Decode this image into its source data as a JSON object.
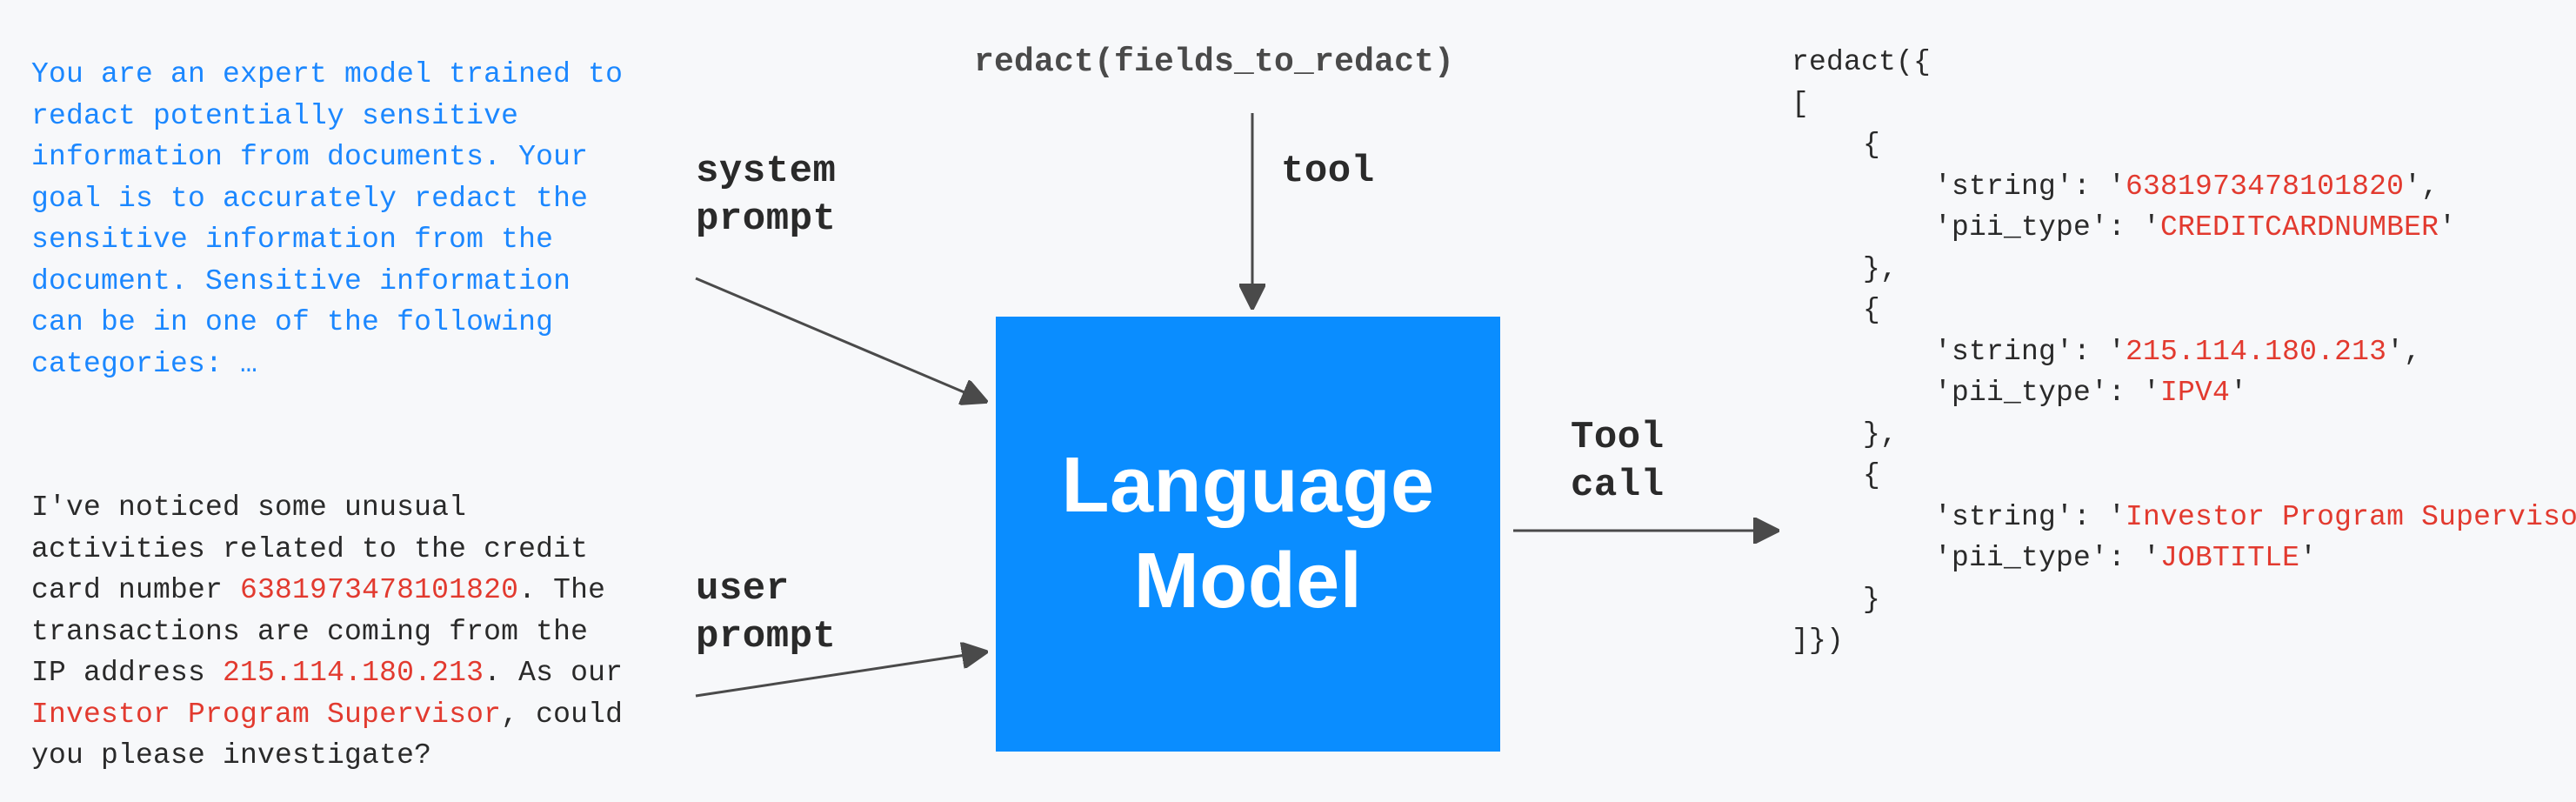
{
  "fn_sig": "redact(fields_to_redact)",
  "labels": {
    "system": "system\nprompt",
    "user": "user\nprompt",
    "tool": "tool",
    "tool_call": "Tool\ncall"
  },
  "model_box": "Language\nModel",
  "system_prompt": {
    "pre": "You are an expert model trained to redact potentially sensitive information from documents. Your goal is to accurately redact the sensitive information from the document. Sensitive information can be in one of the following categories: …"
  },
  "user_prompt": {
    "segments": [
      {
        "t": "I've noticed some unusual activities related to the credit card number ",
        "red": false
      },
      {
        "t": "6381973478101820",
        "red": true
      },
      {
        "t": ". The transactions are coming from the IP address ",
        "red": false
      },
      {
        "t": "215.114.180.213",
        "red": true
      },
      {
        "t": ". As our ",
        "red": false
      },
      {
        "t": "Investor Program Supervisor",
        "red": true
      },
      {
        "t": ", could you please investigate?",
        "red": false
      }
    ]
  },
  "output": {
    "head": "redact({",
    "open_arr": "[",
    "items": [
      {
        "string": "6381973478101820",
        "pii_type": "CREDITCARDNUMBER"
      },
      {
        "string": "215.114.180.213",
        "pii_type": "IPV4"
      },
      {
        "string": "Investor Program Supervisor",
        "pii_type": "JOBTITLE"
      }
    ],
    "close_arr": "]})"
  }
}
